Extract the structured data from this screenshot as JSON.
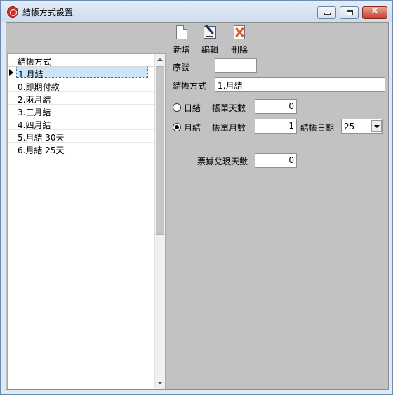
{
  "window": {
    "title": "結帳方式設置",
    "icon": "app-logo-icon",
    "controls": {
      "minimize": "minimize-icon",
      "maximize": "maximize-icon",
      "close": "×"
    }
  },
  "toolbar": {
    "items": [
      {
        "label": "新增",
        "icon": "new-document-icon"
      },
      {
        "label": "編輯",
        "icon": "edit-document-icon"
      },
      {
        "label": "刪除",
        "icon": "delete-document-icon"
      }
    ]
  },
  "list": {
    "header": "結帳方式",
    "rows": [
      {
        "label": "1.月結",
        "selected": true
      },
      {
        "label": "0.即期付款"
      },
      {
        "label": "2.兩月結"
      },
      {
        "label": "3.三月結"
      },
      {
        "label": "4.四月結"
      },
      {
        "label": "5.月結 30天"
      },
      {
        "label": "6.月結 25天"
      }
    ]
  },
  "form": {
    "seq_label": "序號",
    "seq_value": "",
    "method_label": "結帳方式",
    "method_value": "1.月結",
    "daily_option": "日結",
    "daily_selected": false,
    "days_label": "帳單天數",
    "days_value": "0",
    "monthly_option": "月結",
    "monthly_selected": true,
    "months_label": "帳單月數",
    "months_value": "1",
    "day_label": "結帳日期",
    "day_value": "25",
    "cash_days_label": "票據兌現天數",
    "cash_days_value": "0"
  }
}
